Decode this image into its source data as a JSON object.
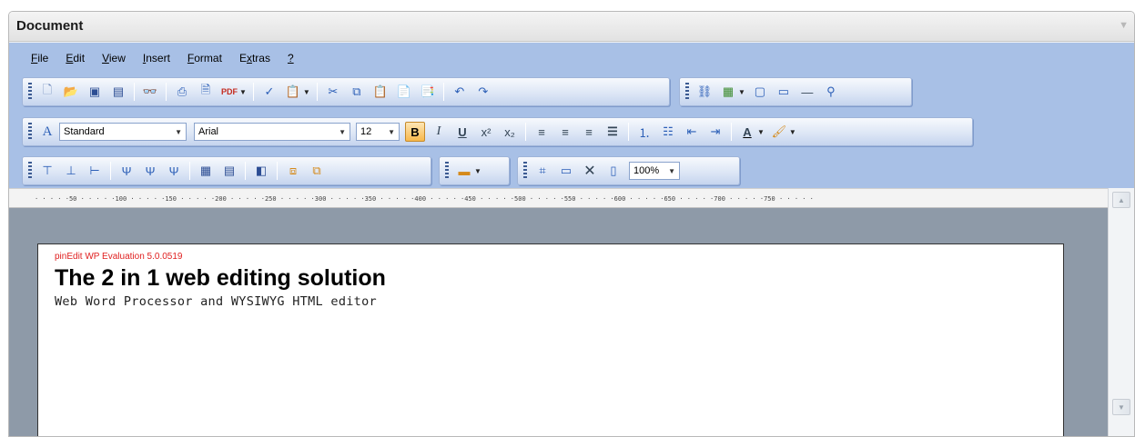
{
  "window": {
    "title": "Document",
    "collapse_icon": "chevron-down-icon"
  },
  "menu": [
    {
      "label": "File",
      "underline": "F",
      "rest": "ile"
    },
    {
      "label": "Edit",
      "underline": "E",
      "rest": "dit"
    },
    {
      "label": "View",
      "underline": "V",
      "rest": "iew"
    },
    {
      "label": "Insert",
      "underline": "I",
      "rest": "nsert"
    },
    {
      "label": "Format",
      "underline": "F",
      "rest": "ormat"
    },
    {
      "label": "Extras",
      "underline": "x",
      "pre": "E",
      "rest": "tras"
    },
    {
      "label": "?",
      "underline": "?",
      "rest": ""
    }
  ],
  "toolbar1": {
    "buttons": [
      "new-document-icon",
      "open-folder-icon",
      "save-icon",
      "save-as-icon",
      "find-icon",
      "print-icon",
      "print-preview-icon",
      "export-pdf-icon",
      "spellcheck-icon",
      "paste-special-icon",
      "cut-icon",
      "copy-icon",
      "paste-icon",
      "paste-text-icon",
      "paste-word-icon",
      "undo-icon",
      "redo-icon"
    ],
    "pdf_label": "PDF"
  },
  "toolbar1b": {
    "buttons": [
      "hyperlink-icon",
      "insert-image-icon",
      "insert-frame-icon",
      "insert-textbox-icon",
      "horizontal-rule-icon",
      "special-character-icon"
    ]
  },
  "toolbar2": {
    "style_value": "Standard",
    "font_value": "Arial",
    "size_value": "12",
    "buttons": [
      "bold-icon",
      "italic-icon",
      "underline-icon",
      "superscript-icon",
      "subscript-icon",
      "align-left-icon",
      "align-center-icon",
      "align-right-icon",
      "align-justify-icon",
      "numbered-list-icon",
      "bullet-list-icon",
      "outdent-icon",
      "indent-icon",
      "font-color-icon",
      "highlight-color-icon"
    ],
    "bold_label": "B",
    "italic_label": "I",
    "underline_label": "U",
    "font_color_label": "A"
  },
  "toolbar3": {
    "buttons": [
      "insert-row-above-icon",
      "insert-row-below-icon",
      "insert-column-icon",
      "delete-row-icon",
      "delete-column-icon",
      "delete-cell-icon",
      "table-icon",
      "table-properties-icon",
      "cell-properties-icon",
      "merge-cells-icon",
      "split-cells-icon"
    ]
  },
  "toolbar3b": {
    "buttons": [
      "colors-icon"
    ]
  },
  "toolbar3c": {
    "buttons": [
      "fit-page-icon",
      "page-width-icon",
      "close-icon",
      "full-page-icon"
    ],
    "zoom_value": "100%"
  },
  "ruler": {
    "labels": [
      "50",
      "100",
      "150",
      "200",
      "250",
      "300",
      "350",
      "400",
      "450",
      "500",
      "550",
      "600",
      "650",
      "700",
      "750"
    ]
  },
  "document": {
    "evaluation_notice": "pinEdit WP Evaluation 5.0.0519",
    "heading": "The 2 in 1 web editing solution",
    "subheading": "Web Word Processor and WYSIWYG HTML editor"
  },
  "colors": {
    "toolbar_background": "#a8c0e6",
    "canvas_background": "#8e9aa8",
    "evaluation_text": "#e02020",
    "active_button": "#f8b84c"
  }
}
